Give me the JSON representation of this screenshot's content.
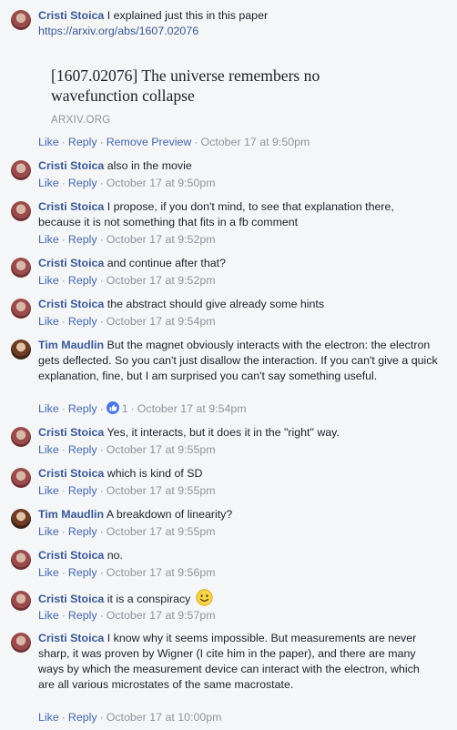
{
  "actions": {
    "like": "Like",
    "reply": "Reply",
    "remove_preview": "Remove Preview",
    "sep": "·"
  },
  "comments": [
    {
      "author": "Cristi Stoica",
      "text": "I explained just this in this paper",
      "link": "https://arxiv.org/abs/1607.02076",
      "time": "October 17 at 9:50pm",
      "preview": {
        "title": "[1607.02076] The universe remembers no wavefunction collapse",
        "domain": "ARXIV.ORG"
      }
    },
    {
      "author": "Cristi Stoica",
      "text": "also in the movie",
      "time": "October 17 at 9:50pm"
    },
    {
      "author": "Cristi Stoica",
      "text": "I propose, if you don't mind, to see that explanation there, because it is not something that fits in a fb comment",
      "time": "October 17 at 9:52pm"
    },
    {
      "author": "Cristi Stoica",
      "text": "and continue after that?",
      "time": "October 17 at 9:52pm"
    },
    {
      "author": "Cristi Stoica",
      "text": "the abstract should give already some hints",
      "time": "October 17 at 9:54pm"
    },
    {
      "author": "Tim Maudlin",
      "text": "But the magnet obviously interacts with the electron: the electron gets deflected. So you can't just disallow the interaction. If you can't give a quick explanation, fine, but I am surprised you can't say something useful.",
      "time": "October 17 at 9:54pm",
      "reactions": "1"
    },
    {
      "author": "Cristi Stoica",
      "text": "Yes, it interacts, but it does it in the \"right\" way.",
      "time": "October 17 at 9:55pm"
    },
    {
      "author": "Cristi Stoica",
      "text": "which is kind of SD",
      "time": "October 17 at 9:55pm"
    },
    {
      "author": "Tim Maudlin",
      "text": "A breakdown of linearity?",
      "time": "October 17 at 9:55pm"
    },
    {
      "author": "Cristi Stoica",
      "text": "no.",
      "time": "October 17 at 9:56pm"
    },
    {
      "author": "Cristi Stoica",
      "text": "it is a conspiracy",
      "time": "October 17 at 9:57pm"
    },
    {
      "author": "Cristi Stoica",
      "text": "I know why it seems impossible. But measurements are never sharp, it was proven by Wigner (I cite him in the paper), and there are many ways by which the measurement device can interact with the electron, which are all various microstates of the same macrostate.",
      "time": "October 17 at 10:00pm"
    }
  ]
}
